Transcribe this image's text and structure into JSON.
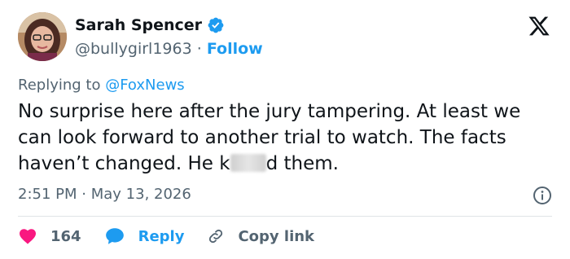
{
  "author": {
    "name": "Sarah Spencer",
    "handle": "@bullygirl1963",
    "separator": "·",
    "follow_label": "Follow"
  },
  "reply_to": {
    "prefix": "Replying to",
    "mention": "@FoxNews"
  },
  "tweet": {
    "text_before": "No surprise here after the jury tampering. At least we can look forward to another trial to watch. The facts haven’t changed. He k",
    "text_after": "d them."
  },
  "meta": {
    "time": "2:51 PM",
    "separator": "·",
    "date": "May 13, 2026"
  },
  "actions": {
    "like_count": "164",
    "reply_label": "Reply",
    "copy_label": "Copy link"
  },
  "colors": {
    "accent": "#1d9bf0",
    "like": "#f91880",
    "muted": "#536471",
    "text": "#0f1419"
  },
  "icons": [
    "verified-badge-icon",
    "x-logo-icon",
    "info-icon",
    "heart-icon",
    "reply-bubble-icon",
    "link-icon"
  ]
}
